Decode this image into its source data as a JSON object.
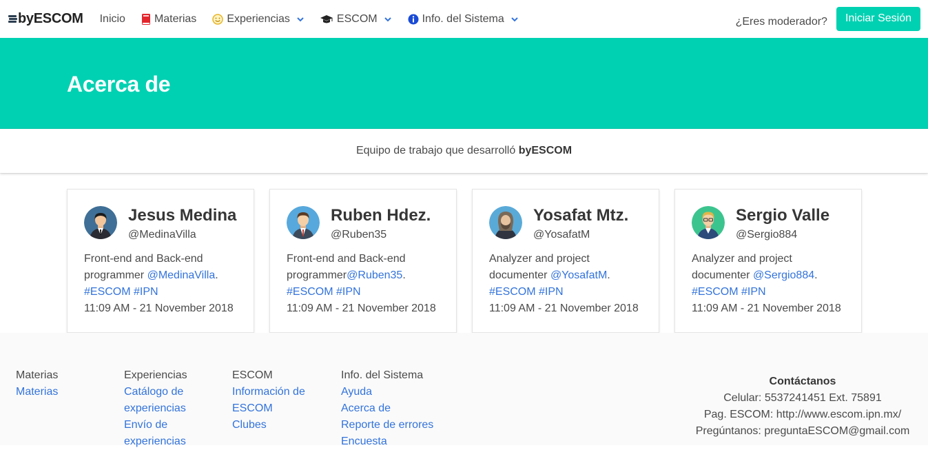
{
  "navbar": {
    "brand": "byESCOM",
    "items": [
      {
        "label": "Inicio"
      },
      {
        "label": "Materias",
        "icon": "book-icon"
      },
      {
        "label": "Experiencias",
        "icon": "smile-icon"
      },
      {
        "label": "ESCOM",
        "icon": "graduation-cap-icon"
      },
      {
        "label": "Info. del Sistema",
        "icon": "info-circle-icon"
      }
    ],
    "moderator_text": "¿Eres moderador?",
    "login_label": "Iniciar Sesión"
  },
  "hero": {
    "title": "Acerca de"
  },
  "subtitle": {
    "text": "Equipo de trabajo que desarrolló ",
    "bold": "byESCOM"
  },
  "team": [
    {
      "name": "Jesus Medina",
      "handle": "@MedinaVilla",
      "role": "Front-end and Back-end programmer ",
      "mention": "@MedinaVilla",
      "tags": "#ESCOM #IPN",
      "date": "11:09 AM - 21 November 2018"
    },
    {
      "name": "Ruben Hdez.",
      "handle": "@Ruben35",
      "role": "Front-end and Back-end programmer",
      "mention": "@Ruben35",
      "tags": "#ESCOM #IPN",
      "date": "11:09 AM - 21 November 2018"
    },
    {
      "name": "Yosafat Mtz.",
      "handle": "@YosafatM",
      "role": "Analyzer and project documenter ",
      "mention": "@YosafatM",
      "tags": "#ESCOM #IPN",
      "date": "11:09 AM - 21 November 2018"
    },
    {
      "name": "Sergio Valle",
      "handle": "@Sergio884",
      "role": "Analyzer and project documenter ",
      "mention": "@Sergio884",
      "tags": "#ESCOM #IPN",
      "date": "11:09 AM - 21 November 2018"
    }
  ],
  "footer": {
    "columns": [
      {
        "heading": "Materias",
        "links": [
          "Materias"
        ]
      },
      {
        "heading": "Experiencias",
        "links": [
          "Catálogo de experiencias",
          "Envío de experiencias"
        ]
      },
      {
        "heading": "ESCOM",
        "links": [
          "Información de ESCOM",
          "Clubes"
        ]
      },
      {
        "heading": "Info. del Sistema",
        "links": [
          "Ayuda",
          "Acerca de",
          "Reporte de errores",
          "Encuesta"
        ]
      }
    ],
    "contact": {
      "heading": "Contáctanos",
      "phone": "Celular: 5537241451 Ext. 75891",
      "page": "Pag. ESCOM: http://www.escom.ipn.mx/",
      "email": "Pregúntanos: preguntaESCOM@gmail.com"
    }
  },
  "colors": {
    "primary": "#00d1b2",
    "link": "#3273dc",
    "text": "#4a4a4a"
  }
}
